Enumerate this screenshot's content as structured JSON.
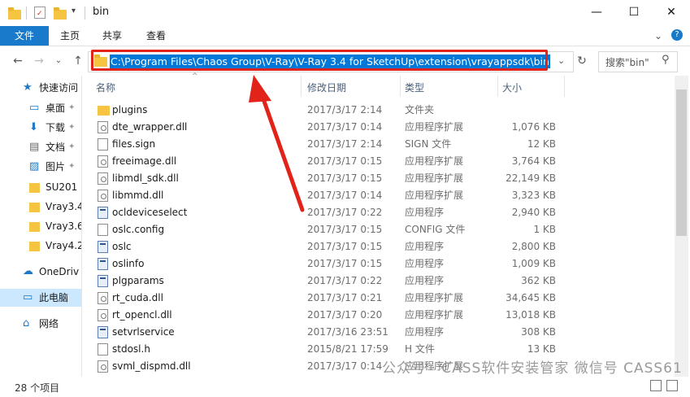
{
  "window": {
    "title": "bin",
    "controls": {
      "minimize": "—",
      "maximize": "☐",
      "close": "✕"
    }
  },
  "ribbon": {
    "tabs": [
      "文件",
      "主页",
      "共享",
      "查看"
    ],
    "expand_icon": "⌄",
    "help_icon": "?"
  },
  "address": {
    "path": "C:\\Program Files\\Chaos Group\\V-Ray\\V-Ray 3.4 for SketchUp\\extension\\vrayappsdk\\bin",
    "search_placeholder": "搜索\"bin\""
  },
  "columns": {
    "name": "名称",
    "date": "修改日期",
    "type": "类型",
    "size": "大小"
  },
  "nav": [
    {
      "label": "快速访问",
      "icon": "star-icon"
    },
    {
      "label": "桌面",
      "icon": "desktop-icon",
      "pinned": true
    },
    {
      "label": "下载",
      "icon": "download-icon",
      "pinned": true
    },
    {
      "label": "文档",
      "icon": "document-icon",
      "pinned": true
    },
    {
      "label": "图片",
      "icon": "picture-icon",
      "pinned": true
    },
    {
      "label": "SU201",
      "icon": "folder-icon"
    },
    {
      "label": "Vray3.4",
      "icon": "folder-icon"
    },
    {
      "label": "Vray3.6",
      "icon": "folder-icon"
    },
    {
      "label": "Vray4.2",
      "icon": "folder-icon"
    },
    {
      "label": "OneDriv",
      "icon": "cloud-icon"
    },
    {
      "label": "此电脑",
      "icon": "computer-icon",
      "selected": true
    },
    {
      "label": "网络",
      "icon": "network-icon"
    }
  ],
  "files": [
    {
      "name": "plugins",
      "date": "2017/3/17 2:14",
      "type": "文件夹",
      "size": "",
      "icon": "folder"
    },
    {
      "name": "dte_wrapper.dll",
      "date": "2017/3/17 0:14",
      "type": "应用程序扩展",
      "size": "1,076 KB",
      "icon": "dll"
    },
    {
      "name": "files.sign",
      "date": "2017/3/17 2:14",
      "type": "SIGN 文件",
      "size": "12 KB",
      "icon": "doc"
    },
    {
      "name": "freeimage.dll",
      "date": "2017/3/17 0:15",
      "type": "应用程序扩展",
      "size": "3,764 KB",
      "icon": "dll"
    },
    {
      "name": "libmdl_sdk.dll",
      "date": "2017/3/17 0:15",
      "type": "应用程序扩展",
      "size": "22,149 KB",
      "icon": "dll"
    },
    {
      "name": "libmmd.dll",
      "date": "2017/3/17 0:14",
      "type": "应用程序扩展",
      "size": "3,323 KB",
      "icon": "dll"
    },
    {
      "name": "ocldeviceselect",
      "date": "2017/3/17 0:22",
      "type": "应用程序",
      "size": "2,940 KB",
      "icon": "exe"
    },
    {
      "name": "oslc.config",
      "date": "2017/3/17 0:15",
      "type": "CONFIG 文件",
      "size": "1 KB",
      "icon": "doc"
    },
    {
      "name": "oslc",
      "date": "2017/3/17 0:15",
      "type": "应用程序",
      "size": "2,800 KB",
      "icon": "exe"
    },
    {
      "name": "oslinfo",
      "date": "2017/3/17 0:15",
      "type": "应用程序",
      "size": "1,009 KB",
      "icon": "exe"
    },
    {
      "name": "plgparams",
      "date": "2017/3/17 0:22",
      "type": "应用程序",
      "size": "362 KB",
      "icon": "exe"
    },
    {
      "name": "rt_cuda.dll",
      "date": "2017/3/17 0:21",
      "type": "应用程序扩展",
      "size": "34,645 KB",
      "icon": "dll"
    },
    {
      "name": "rt_opencl.dll",
      "date": "2017/3/17 0:20",
      "type": "应用程序扩展",
      "size": "13,018 KB",
      "icon": "dll"
    },
    {
      "name": "setvrlservice",
      "date": "2017/3/16 23:51",
      "type": "应用程序",
      "size": "308 KB",
      "icon": "exe"
    },
    {
      "name": "stdosl.h",
      "date": "2015/8/21 17:59",
      "type": "H 文件",
      "size": "13 KB",
      "icon": "doc"
    },
    {
      "name": "svml_dispmd.dll",
      "date": "2017/3/17 0:14",
      "type": "应用程序扩展",
      "size": "",
      "icon": "dll"
    }
  ],
  "status": {
    "count": "28 个项目"
  },
  "watermark": "公众号 · CASS软件安装管家 微信号 CASS61",
  "colors": {
    "accent": "#1979ca",
    "highlight": "#e2231a",
    "selection": "#0078d7"
  }
}
